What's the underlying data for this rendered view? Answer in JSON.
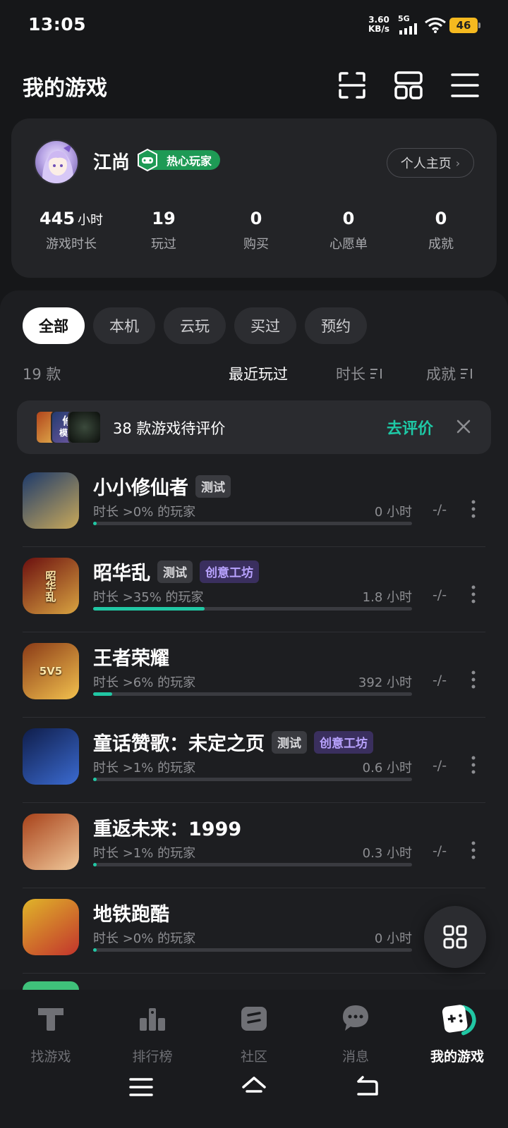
{
  "status_bar": {
    "time": "13:05",
    "net_speed_value": "3.60",
    "net_speed_unit": "KB/s",
    "network": "5G",
    "battery": "46"
  },
  "header": {
    "title": "我的游戏",
    "icons": [
      "scan-icon",
      "layout-grid-icon",
      "menu-icon"
    ]
  },
  "profile": {
    "name": "江尚",
    "badge": "热心玩家",
    "homepage_label": "个人主页",
    "stats": [
      {
        "value": "445",
        "unit": "小时",
        "label": "游戏时长"
      },
      {
        "value": "19",
        "unit": "",
        "label": "玩过"
      },
      {
        "value": "0",
        "unit": "",
        "label": "购买"
      },
      {
        "value": "0",
        "unit": "",
        "label": "心愿单"
      },
      {
        "value": "0",
        "unit": "",
        "label": "成就"
      }
    ]
  },
  "filters": {
    "chips": [
      "全部",
      "本机",
      "云玩",
      "买过",
      "预约"
    ],
    "active_index": 0
  },
  "list_header": {
    "count": "19 款",
    "sort_recent": "最近玩过",
    "sort_duration": "时长",
    "sort_achievement": "成就"
  },
  "rate_banner": {
    "text": "38 款游戏待评价",
    "action": "去评价",
    "thumb_text": "修",
    "thumb_text2": "模拟"
  },
  "games": [
    {
      "name": "小小修仙者",
      "tags": [
        "测试"
      ],
      "sub": "时长 >0% 的玩家",
      "hours": "0 小时",
      "ach": "-/-",
      "progress": 0.01,
      "colors": [
        "#1d3a6b",
        "#c9a95a"
      ]
    },
    {
      "name": "昭华乱",
      "tags": [
        "测试",
        "创意工坊"
      ],
      "sub": "时长 >35% 的玩家",
      "hours": "1.8 小时",
      "ach": "-/-",
      "progress": 0.35,
      "colors": [
        "#6b0f0f",
        "#d9a441"
      ],
      "icon_text": "昭华乱"
    },
    {
      "name": "王者荣耀",
      "tags": [],
      "sub": "时长 >6% 的玩家",
      "hours": "392 小时",
      "ach": "-/-",
      "progress": 0.06,
      "colors": [
        "#8a3a17",
        "#f2c14e"
      ],
      "icon_text": "5V5"
    },
    {
      "name": "童话赞歌：未定之页",
      "tags": [
        "测试",
        "创意工坊"
      ],
      "sub": "时长 >1% 的玩家",
      "hours": "0.6 小时",
      "ach": "-/-",
      "progress": 0.01,
      "colors": [
        "#0f1d4a",
        "#3b6bd1"
      ]
    },
    {
      "name": "重返未来：1999",
      "tags": [],
      "sub": "时长 >1% 的玩家",
      "hours": "0.3 小时",
      "ach": "-/-",
      "progress": 0.01,
      "colors": [
        "#a8421a",
        "#f0c89a"
      ]
    },
    {
      "name": "地铁跑酷",
      "tags": [],
      "sub": "时长 >0% 的玩家",
      "hours": "0 小时",
      "ach": "",
      "progress": 0.01,
      "colors": [
        "#e0b52a",
        "#c2342c"
      ]
    }
  ],
  "bottom_nav": [
    {
      "label": "找游戏",
      "icon": "discover-icon",
      "active": false
    },
    {
      "label": "排行榜",
      "icon": "ranking-icon",
      "active": false
    },
    {
      "label": "社区",
      "icon": "community-icon",
      "active": false
    },
    {
      "label": "消息",
      "icon": "message-icon",
      "active": false
    },
    {
      "label": "我的游戏",
      "icon": "my-games-icon",
      "active": true
    }
  ],
  "accent_color": "#21c7a4",
  "workshop_color": "#b9a3ff"
}
